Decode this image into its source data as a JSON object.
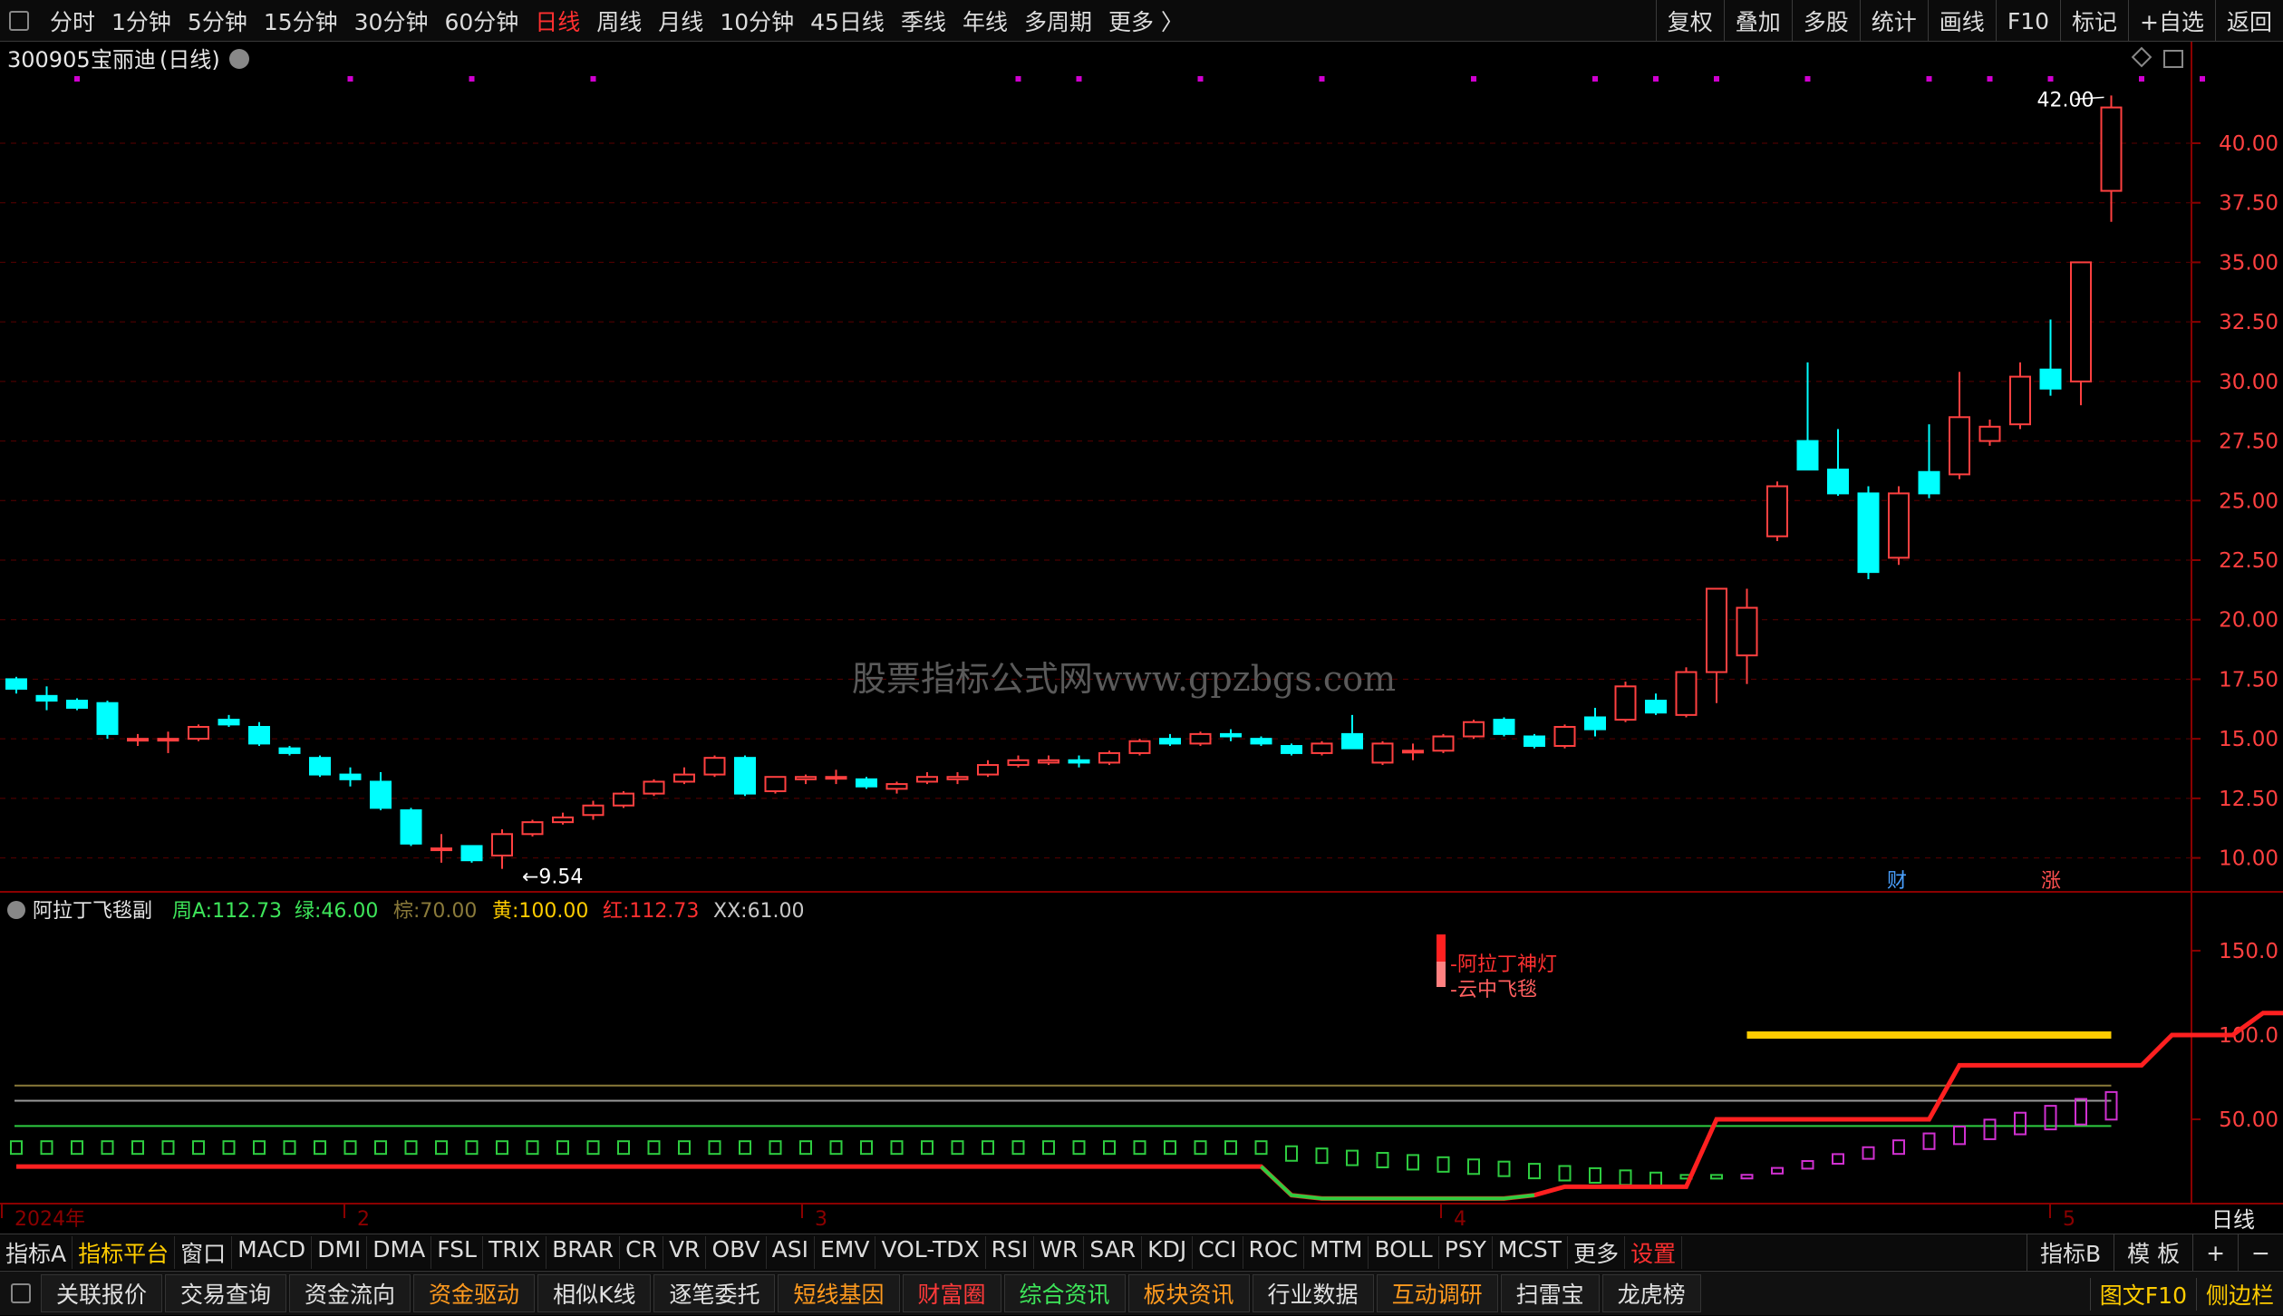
{
  "toolbar": {
    "periods": [
      "分时",
      "1分钟",
      "5分钟",
      "15分钟",
      "30分钟",
      "60分钟",
      "日线",
      "周线",
      "月线",
      "10分钟",
      "45日线",
      "季线",
      "年线",
      "多周期",
      "更多 〉"
    ],
    "active_period": "日线",
    "right_buttons": [
      "复权",
      "叠加",
      "多股",
      "统计",
      "画线",
      "F10",
      "标记",
      "+自选",
      "返回"
    ]
  },
  "stock": {
    "code": "300905",
    "name": "宝丽迪",
    "period_label": "(日线)"
  },
  "price_axis": {
    "labels": [
      "40.00",
      "37.50",
      "35.00",
      "32.50",
      "30.00",
      "27.50",
      "25.00",
      "22.50",
      "20.00",
      "17.50",
      "15.00",
      "12.50",
      "10.00"
    ]
  },
  "annotations": {
    "high": "42.00",
    "low": "9.54",
    "badge_finance": "财",
    "badge_rise": "涨"
  },
  "watermark": "股票指标公式网www.gpzbgs.com",
  "indicator": {
    "name": "阿拉丁飞毯副",
    "values": [
      {
        "label": "周A:",
        "value": "112.73",
        "color": "#3ee65a"
      },
      {
        "label": "绿:",
        "value": "46.00",
        "color": "#3ee65a"
      },
      {
        "label": "棕:",
        "value": "70.00",
        "color": "#8a7a3a"
      },
      {
        "label": "黄:",
        "value": "100.00",
        "color": "#ffcc00"
      },
      {
        "label": "红:",
        "value": "112.73",
        "color": "#ff3030"
      },
      {
        "label": "XX:",
        "value": "61.00",
        "color": "#c8c8c8"
      }
    ],
    "axis_labels": [
      "150.0",
      "100.0",
      "50.00"
    ],
    "legend": [
      "阿拉丁神灯",
      "云中飞毯"
    ]
  },
  "date_axis": {
    "labels": [
      "2024年",
      "2",
      "3",
      "4",
      "5"
    ],
    "period": "日线"
  },
  "indicator_tabs": [
    "指标A",
    "指标平台",
    "窗口",
    "MACD",
    "DMI",
    "DMA",
    "FSL",
    "TRIX",
    "BRAR",
    "CR",
    "VR",
    "OBV",
    "ASI",
    "EMV",
    "VOL-TDX",
    "RSI",
    "WR",
    "SAR",
    "KDJ",
    "CCI",
    "ROC",
    "MTM",
    "BOLL",
    "PSY",
    "MCST",
    "更多",
    "设置"
  ],
  "indicator_tabs_right": [
    "指标B",
    "模 板",
    "+",
    "−"
  ],
  "function_bar": [
    "关联报价",
    "交易查询",
    "资金流向",
    "资金驱动",
    "相似K线",
    "逐笔委托",
    "短线基因",
    "财富圈",
    "综合资讯",
    "板块资讯",
    "行业数据",
    "互动调研",
    "扫雷宝",
    "龙虎榜"
  ],
  "function_bar_right": [
    "图文F10",
    "侧边栏"
  ],
  "colors": {
    "up": "#ff4040",
    "down": "#00ffff",
    "grid": "#5a0000",
    "axis": "#8b0000"
  },
  "chart_data": {
    "type": "candlestick",
    "ylim": [
      8.5,
      43.5
    ],
    "candles": [
      {
        "o": 17.5,
        "h": 17.6,
        "l": 16.9,
        "c": 17.1
      },
      {
        "o": 16.8,
        "h": 17.2,
        "l": 16.2,
        "c": 16.6
      },
      {
        "o": 16.6,
        "h": 16.7,
        "l": 16.2,
        "c": 16.3
      },
      {
        "o": 16.5,
        "h": 16.6,
        "l": 15.0,
        "c": 15.2
      },
      {
        "o": 15.0,
        "h": 15.2,
        "l": 14.7,
        "c": 15.0
      },
      {
        "o": 15.0,
        "h": 15.3,
        "l": 14.4,
        "c": 15.0
      },
      {
        "o": 15.0,
        "h": 15.6,
        "l": 14.9,
        "c": 15.5
      },
      {
        "o": 15.8,
        "h": 16.0,
        "l": 15.5,
        "c": 15.6
      },
      {
        "o": 15.5,
        "h": 15.7,
        "l": 14.7,
        "c": 14.8
      },
      {
        "o": 14.6,
        "h": 14.7,
        "l": 14.3,
        "c": 14.4
      },
      {
        "o": 14.2,
        "h": 14.3,
        "l": 13.4,
        "c": 13.5
      },
      {
        "o": 13.5,
        "h": 13.8,
        "l": 13.0,
        "c": 13.3
      },
      {
        "o": 13.2,
        "h": 13.6,
        "l": 12.0,
        "c": 12.1
      },
      {
        "o": 12.0,
        "h": 12.1,
        "l": 10.5,
        "c": 10.6
      },
      {
        "o": 10.4,
        "h": 11.0,
        "l": 9.8,
        "c": 10.4
      },
      {
        "o": 10.5,
        "h": 10.5,
        "l": 9.8,
        "c": 9.9
      },
      {
        "o": 10.1,
        "h": 11.2,
        "l": 9.54,
        "c": 11.0
      },
      {
        "o": 11.0,
        "h": 11.6,
        "l": 10.9,
        "c": 11.5
      },
      {
        "o": 11.5,
        "h": 11.9,
        "l": 11.4,
        "c": 11.7
      },
      {
        "o": 11.8,
        "h": 12.4,
        "l": 11.6,
        "c": 12.2
      },
      {
        "o": 12.2,
        "h": 12.8,
        "l": 12.1,
        "c": 12.7
      },
      {
        "o": 12.7,
        "h": 13.3,
        "l": 12.6,
        "c": 13.2
      },
      {
        "o": 13.2,
        "h": 13.8,
        "l": 13.1,
        "c": 13.5
      },
      {
        "o": 13.5,
        "h": 14.3,
        "l": 13.4,
        "c": 14.2
      },
      {
        "o": 14.2,
        "h": 14.3,
        "l": 12.6,
        "c": 12.7
      },
      {
        "o": 12.8,
        "h": 13.4,
        "l": 12.7,
        "c": 13.4
      },
      {
        "o": 13.3,
        "h": 13.5,
        "l": 13.1,
        "c": 13.4
      },
      {
        "o": 13.4,
        "h": 13.7,
        "l": 13.1,
        "c": 13.4
      },
      {
        "o": 13.3,
        "h": 13.4,
        "l": 12.9,
        "c": 13.0
      },
      {
        "o": 12.9,
        "h": 13.2,
        "l": 12.7,
        "c": 13.1
      },
      {
        "o": 13.2,
        "h": 13.6,
        "l": 13.1,
        "c": 13.4
      },
      {
        "o": 13.3,
        "h": 13.6,
        "l": 13.1,
        "c": 13.4
      },
      {
        "o": 13.5,
        "h": 14.1,
        "l": 13.4,
        "c": 13.9
      },
      {
        "o": 13.9,
        "h": 14.3,
        "l": 13.8,
        "c": 14.1
      },
      {
        "o": 14.0,
        "h": 14.3,
        "l": 13.9,
        "c": 14.1
      },
      {
        "o": 14.1,
        "h": 14.3,
        "l": 13.8,
        "c": 14.0
      },
      {
        "o": 14.0,
        "h": 14.5,
        "l": 13.9,
        "c": 14.4
      },
      {
        "o": 14.4,
        "h": 15.0,
        "l": 14.3,
        "c": 14.9
      },
      {
        "o": 15.0,
        "h": 15.2,
        "l": 14.7,
        "c": 14.8
      },
      {
        "o": 14.8,
        "h": 15.3,
        "l": 14.7,
        "c": 15.2
      },
      {
        "o": 15.2,
        "h": 15.4,
        "l": 14.9,
        "c": 15.1
      },
      {
        "o": 15.0,
        "h": 15.1,
        "l": 14.7,
        "c": 14.8
      },
      {
        "o": 14.7,
        "h": 14.8,
        "l": 14.3,
        "c": 14.4
      },
      {
        "o": 14.4,
        "h": 14.9,
        "l": 14.3,
        "c": 14.8
      },
      {
        "o": 15.2,
        "h": 16.0,
        "l": 14.7,
        "c": 14.6
      },
      {
        "o": 14.0,
        "h": 14.9,
        "l": 13.9,
        "c": 14.8
      },
      {
        "o": 14.5,
        "h": 14.8,
        "l": 14.1,
        "c": 14.5
      },
      {
        "o": 14.5,
        "h": 15.2,
        "l": 14.4,
        "c": 15.1
      },
      {
        "o": 15.1,
        "h": 15.8,
        "l": 15.0,
        "c": 15.7
      },
      {
        "o": 15.8,
        "h": 15.9,
        "l": 15.1,
        "c": 15.2
      },
      {
        "o": 15.1,
        "h": 15.2,
        "l": 14.6,
        "c": 14.7
      },
      {
        "o": 14.7,
        "h": 15.6,
        "l": 14.6,
        "c": 15.5
      },
      {
        "o": 15.9,
        "h": 16.3,
        "l": 15.1,
        "c": 15.4
      },
      {
        "o": 15.8,
        "h": 17.4,
        "l": 15.7,
        "c": 17.2
      },
      {
        "o": 16.6,
        "h": 16.9,
        "l": 16.0,
        "c": 16.1
      },
      {
        "o": 16.0,
        "h": 18.0,
        "l": 15.9,
        "c": 17.8
      },
      {
        "o": 17.8,
        "h": 19.0,
        "l": 16.5,
        "c": 21.3
      },
      {
        "o": 18.5,
        "h": 21.3,
        "l": 17.3,
        "c": 20.5
      },
      {
        "o": 23.5,
        "h": 25.8,
        "l": 23.3,
        "c": 25.6
      },
      {
        "o": 27.5,
        "h": 30.8,
        "l": 26.5,
        "c": 26.3
      },
      {
        "o": 26.3,
        "h": 28.0,
        "l": 25.2,
        "c": 25.3
      },
      {
        "o": 25.3,
        "h": 25.6,
        "l": 21.7,
        "c": 22.0
      },
      {
        "o": 22.6,
        "h": 25.6,
        "l": 22.3,
        "c": 25.3
      },
      {
        "o": 26.2,
        "h": 28.2,
        "l": 25.1,
        "c": 25.3
      },
      {
        "o": 26.1,
        "h": 30.4,
        "l": 25.9,
        "c": 28.5
      },
      {
        "o": 27.5,
        "h": 28.4,
        "l": 27.3,
        "c": 28.1
      },
      {
        "o": 28.2,
        "h": 30.8,
        "l": 28.0,
        "c": 30.2
      },
      {
        "o": 30.5,
        "h": 32.6,
        "l": 29.4,
        "c": 29.7
      },
      {
        "o": 30.0,
        "h": 35.0,
        "l": 29.0,
        "c": 35.0
      },
      {
        "o": 38.0,
        "h": 42.0,
        "l": 36.7,
        "c": 41.5
      }
    ],
    "indicator_series": {
      "ylim": [
        0,
        165
      ],
      "levels": {
        "brown": 70,
        "gray": 61,
        "green": 46
      },
      "red": [
        22,
        22,
        22,
        22,
        22,
        22,
        22,
        22,
        22,
        22,
        22,
        22,
        22,
        22,
        22,
        22,
        22,
        22,
        22,
        22,
        22,
        22,
        22,
        22,
        22,
        22,
        22,
        22,
        22,
        22,
        22,
        22,
        22,
        22,
        22,
        22,
        22,
        22,
        22,
        22,
        22,
        22,
        5,
        3,
        3,
        3,
        3,
        3,
        3,
        3,
        5,
        10,
        10,
        10,
        10,
        10,
        50,
        50,
        50,
        50,
        50,
        50,
        50,
        50,
        82,
        82,
        82,
        82,
        82,
        82,
        82,
        100,
        100,
        100,
        113,
        113
      ],
      "yellow_start": 57,
      "yellow": 100
    }
  }
}
